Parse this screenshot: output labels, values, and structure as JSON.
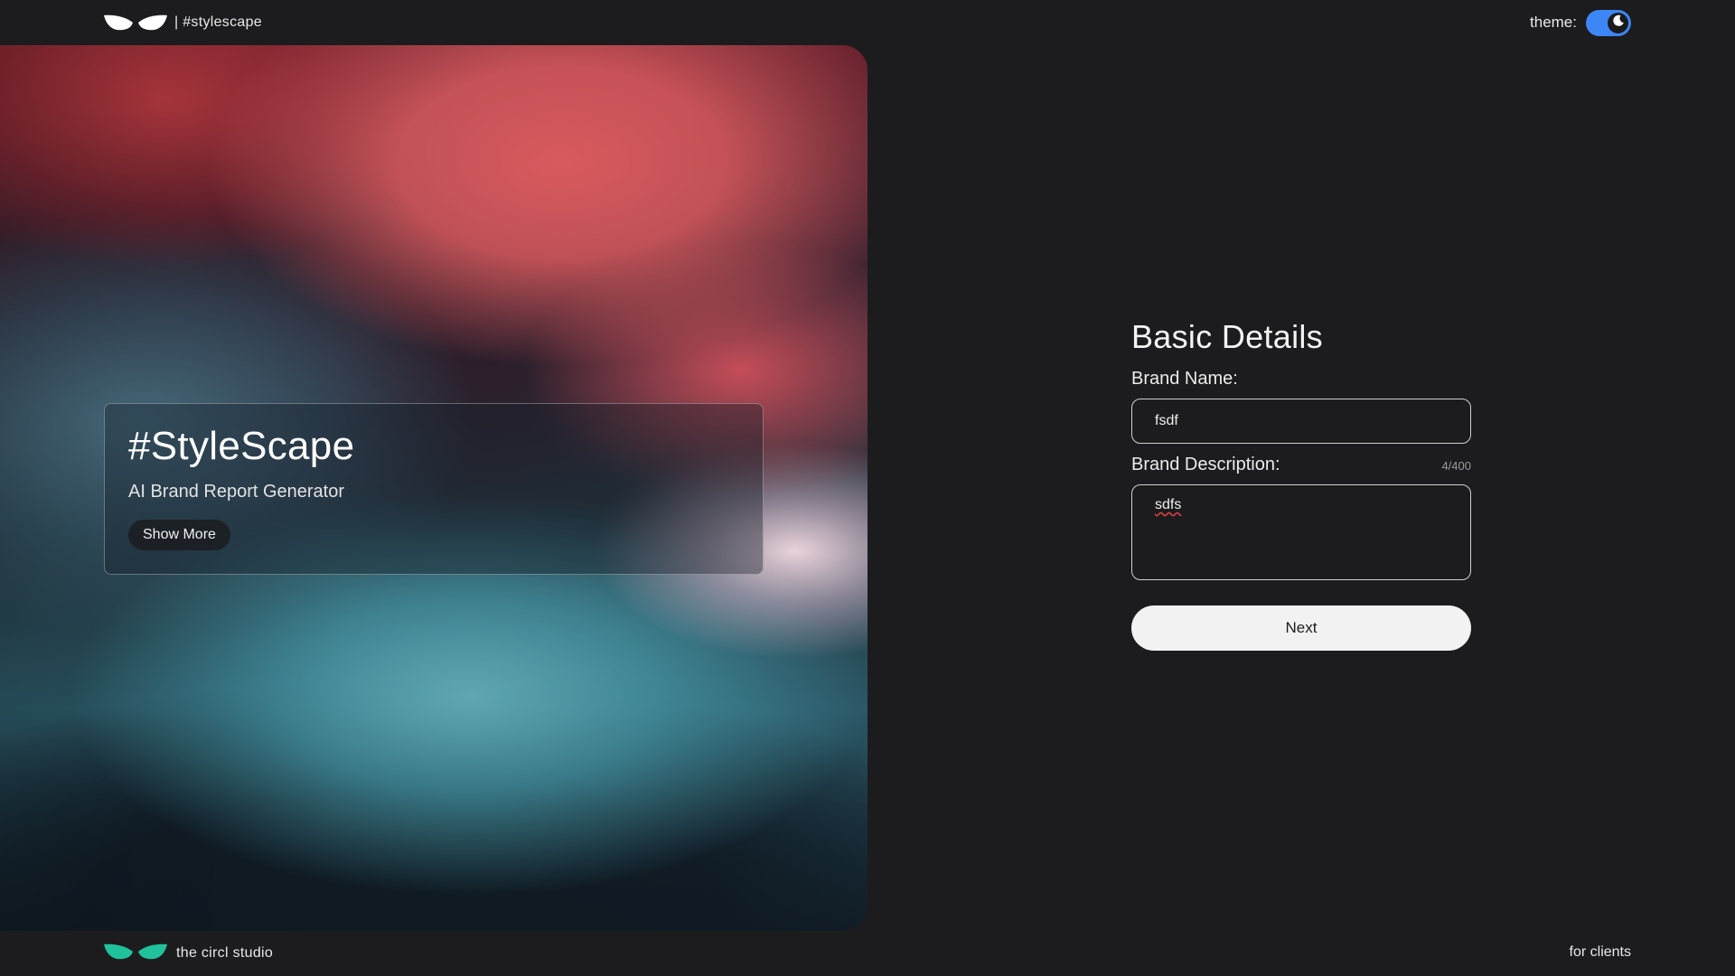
{
  "header": {
    "brand_text": "| #stylescape",
    "theme_label": "theme:"
  },
  "hero": {
    "title": "#StyleScape",
    "subtitle": "AI Brand Report Generator",
    "show_more_label": "Show More"
  },
  "form": {
    "title": "Basic Details",
    "brand_name_label": "Brand Name:",
    "brand_name_value": "fsdf",
    "brand_description_label": "Brand Description:",
    "brand_description_value": "sdfs",
    "char_counter": "4/400",
    "next_label": "Next"
  },
  "footer": {
    "brand_text": "the circl studio",
    "link_label": "for clients"
  },
  "colors": {
    "background": "#1c1c1e",
    "toggle_accent": "#3d86f6",
    "footer_logo": "#1fc29a",
    "header_logo": "#ffffff"
  },
  "icons": [
    "leaf-logo-icon",
    "moon-icon"
  ]
}
